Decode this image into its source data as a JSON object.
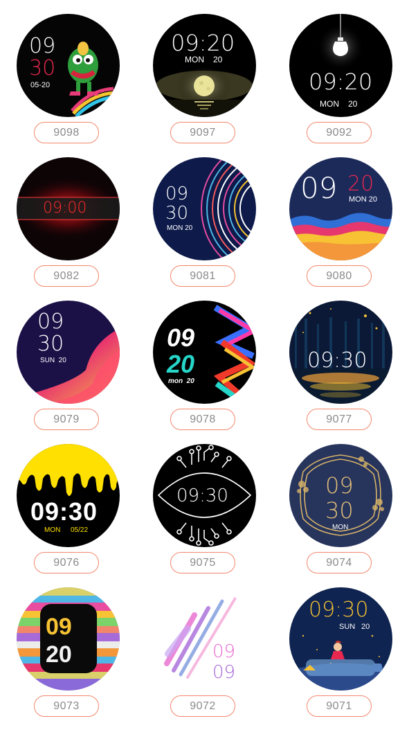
{
  "faces": [
    {
      "id": "9098",
      "hour": "09",
      "minute": "30",
      "date": "05-20"
    },
    {
      "id": "9097",
      "time": "09:20",
      "day": "MON",
      "date": "20"
    },
    {
      "id": "9092",
      "time": "09:20",
      "day": "MON",
      "date": "20"
    },
    {
      "id": "9082",
      "time": "09:00"
    },
    {
      "id": "9081",
      "hour": "09",
      "minute": "30",
      "daydate": "MON 20"
    },
    {
      "id": "9080",
      "hour": "09",
      "minute": "20",
      "daydate": "MON 20"
    },
    {
      "id": "9079",
      "hour": "09",
      "minute": "30",
      "daydate": "SUN  20"
    },
    {
      "id": "9078",
      "hour": "09",
      "minute": "20",
      "daydate": "mon  20"
    },
    {
      "id": "9077",
      "time": "09:30"
    },
    {
      "id": "9076",
      "time": "09:30",
      "day": "MON",
      "date": "05/22"
    },
    {
      "id": "9075",
      "time": "09:30"
    },
    {
      "id": "9074",
      "hour": "09",
      "minute": "30",
      "day": "MON"
    },
    {
      "id": "9073",
      "hour": "09",
      "minute": "20"
    },
    {
      "id": "9072",
      "hour": "09",
      "minute": "09"
    },
    {
      "id": "9071",
      "time": "09:30",
      "day": "SUN",
      "date": "20"
    }
  ],
  "colors": {
    "pill_border": "#f2866c",
    "pill_text": "#8a8a8a",
    "accent_red": "#e8284f"
  }
}
